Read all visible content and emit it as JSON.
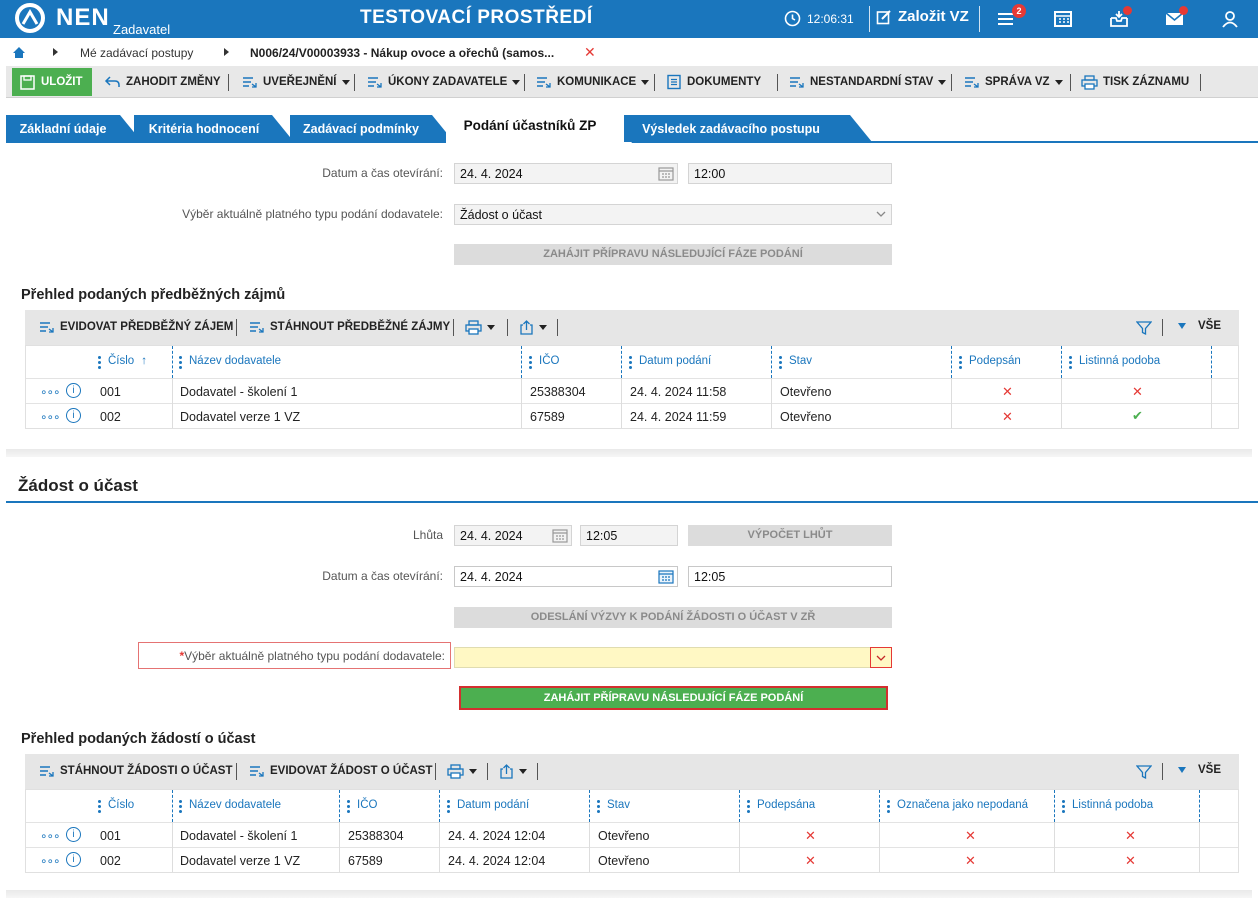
{
  "header": {
    "logo_text": "NEN",
    "logo_sub": "Zadavatel",
    "env_title": "TESTOVACÍ PROSTŘEDÍ",
    "time": "12:06:31",
    "new_vz": "Založit VZ",
    "menu_badge": "2"
  },
  "breadcrumb": {
    "item1": "Mé zadávací postupy",
    "item2": "N006/24/V00003933 - Nákup ovoce a ořechů (samos..."
  },
  "toolbar": {
    "save": "ULOŽIT",
    "discard": "ZAHODIT ZMĚNY",
    "publish": "UVEŘEJNĚNÍ",
    "actions": "ÚKONY ZADAVATELE",
    "communication": "KOMUNIKACE",
    "documents": "DOKUMENTY",
    "nonstandard": "NESTANDARDNÍ STAV",
    "management": "SPRÁVA VZ",
    "print": "TISK ZÁZNAMU"
  },
  "tabs": [
    "Základní údaje",
    "Kritéria hodnocení",
    "Zadávací podmínky",
    "Podání účastníků ZP",
    "Výsledek zadávacího postupu"
  ],
  "section1": {
    "opening_label": "Datum a čas otevírání:",
    "opening_date": "24. 4. 2024",
    "opening_time": "12:00",
    "type_label": "Výběr aktuálně platného typu podání dodavatele:",
    "type_value": "Žádost o účast",
    "next_phase_btn": "ZAHÁJIT PŘÍPRAVU NÁSLEDUJÍCÍ FÁZE PODÁNÍ",
    "grid_title": "Přehled podaných předběžných zájmů",
    "grid_btn1": "EVIDOVAT PŘEDBĚŽNÝ ZÁJEM",
    "grid_btn2": "STÁHNOUT PŘEDBĚŽNÉ ZÁJMY",
    "grid_all": "VŠE",
    "columns": [
      "Číslo",
      "Název dodavatele",
      "IČO",
      "Datum podání",
      "Stav",
      "Podepsán",
      "Listinná podoba"
    ],
    "rows": [
      {
        "num": "001",
        "name": "Dodavatel - školení 1",
        "ico": "25388304",
        "date": "24. 4. 2024 11:58",
        "state": "Otevřeno",
        "signed": "✕",
        "paper": "✕"
      },
      {
        "num": "002",
        "name": "Dodavatel verze 1 VZ",
        "ico": "67589",
        "date": "24. 4. 2024 11:59",
        "state": "Otevřeno",
        "signed": "✕",
        "paper": "✔"
      }
    ]
  },
  "section2": {
    "title": "Žádost o účast",
    "deadline_label": "Lhůta",
    "deadline_date": "24. 4. 2024",
    "deadline_time": "12:05",
    "calc_btn": "VÝPOČET LHŮT",
    "opening_label": "Datum a čas otevírání:",
    "opening_date": "24. 4. 2024",
    "opening_time": "12:05",
    "send_btn": "ODESLÁNÍ VÝZVY K PODÁNÍ ŽÁDOSTI O ÚČAST V ZŘ",
    "type_label": "Výběr aktuálně platného typu podání dodavatele:",
    "type_required": "*",
    "type_value": "",
    "next_phase_btn": "ZAHÁJIT PŘÍPRAVU NÁSLEDUJÍCÍ FÁZE PODÁNÍ",
    "grid_title": "Přehled podaných žádostí o účast",
    "grid_btn1": "STÁHNOUT ŽÁDOSTI O ÚČAST",
    "grid_btn2": "EVIDOVAT ŽÁDOST O ÚČAST",
    "grid_all": "VŠE",
    "columns": [
      "Číslo",
      "Název dodavatele",
      "IČO",
      "Datum podání",
      "Stav",
      "Podepsána",
      "Označena jako nepodaná",
      "Listinná podoba"
    ],
    "rows": [
      {
        "num": "001",
        "name": "Dodavatel - školení 1",
        "ico": "25388304",
        "date": "24. 4. 2024 12:04",
        "state": "Otevřeno",
        "signed": "✕",
        "not_submitted": "✕",
        "paper": "✕"
      },
      {
        "num": "002",
        "name": "Dodavatel verze 1 VZ",
        "ico": "67589",
        "date": "24. 4. 2024 12:04",
        "state": "Otevřeno",
        "signed": "✕",
        "not_submitted": "✕",
        "paper": "✕"
      }
    ]
  },
  "colors": {
    "brand": "#1a76bd",
    "save": "#4caf50",
    "error": "#e53935",
    "required_bg": "#fff8c4"
  }
}
